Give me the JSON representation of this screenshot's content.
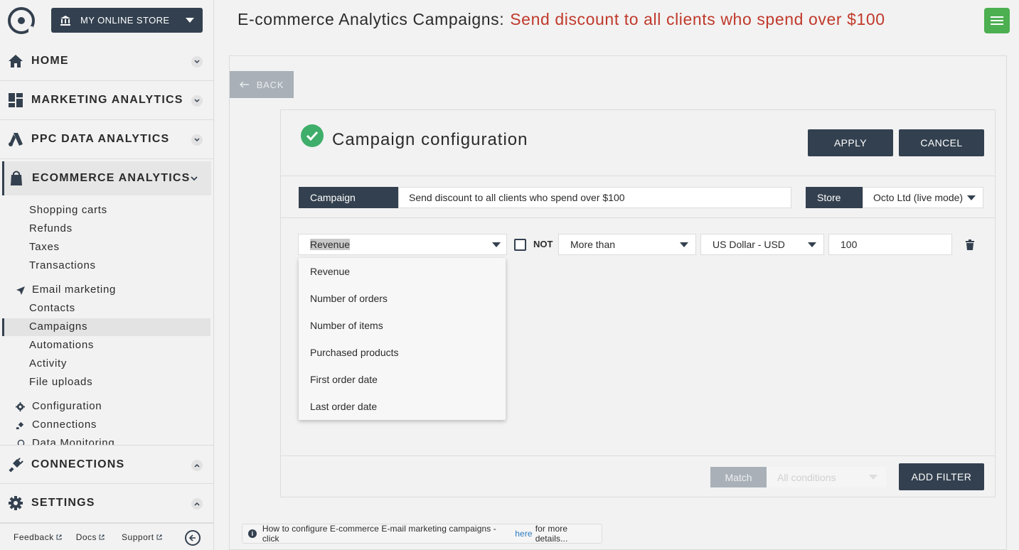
{
  "store_selector": {
    "label": "MY ONLINE STORE"
  },
  "nav": {
    "home": "HOME",
    "marketing_analytics": "MARKETING ANALYTICS",
    "ppc": "PPC DATA ANALYTICS",
    "ecommerce": "ECOMMERCE ANALYTICS",
    "connections": "CONNECTIONS",
    "settings": "SETTINGS"
  },
  "ecommerce_items": {
    "shopping_carts": "Shopping carts",
    "refunds": "Refunds",
    "taxes": "Taxes",
    "transactions": "Transactions",
    "email_marketing": "Email marketing",
    "contacts": "Contacts",
    "campaigns": "Campaigns",
    "automations": "Automations",
    "activity": "Activity",
    "file_uploads": "File uploads",
    "configuration": "Configuration",
    "connections": "Connections",
    "data_monitoring": "Data Monitoring"
  },
  "footer_links": {
    "feedback": "Feedback",
    "docs": "Docs",
    "support": "Support"
  },
  "header": {
    "title": "E-commerce Analytics Campaigns:",
    "campaign_name": "Send discount to all clients who spend over $100"
  },
  "back_label": "BACK",
  "card": {
    "title": "Campaign configuration",
    "apply": "APPLY",
    "cancel": "CANCEL",
    "campaign_label": "Campaign",
    "campaign_value": "Send discount to all clients who spend over $100",
    "store_label": "Store",
    "store_value": "Octo Ltd (live mode)"
  },
  "filter": {
    "field": "Revenue",
    "not_label": "NOT",
    "operator": "More than",
    "currency": "US Dollar - USD",
    "value": "100"
  },
  "dropdown_options": [
    "Revenue",
    "Number of orders",
    "Number of items",
    "Purchased products",
    "First order date",
    "Last order date"
  ],
  "footer": {
    "match_label": "Match",
    "match_value": "All conditions",
    "add_filter": "ADD FILTER"
  },
  "info": {
    "text_before": "How to configure E-commerce E-mail marketing campaigns - click",
    "link": "here",
    "text_after": "for more details..."
  },
  "colors": {
    "dark": "#33404f",
    "accent_red": "#c0392b",
    "success_green": "#3fae6a",
    "menu_green": "#4caf50",
    "link_blue": "#2b7bbf"
  }
}
